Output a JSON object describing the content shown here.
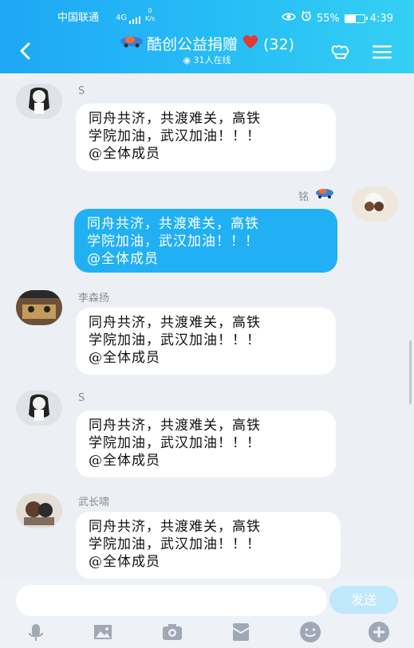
{
  "status": {
    "carrier": "中国联通",
    "signal": "4G",
    "net_speed_top": "0",
    "net_speed_bottom": "K/s",
    "battery": "55%",
    "time": "4:39"
  },
  "header": {
    "title": "酷创公益捐赠",
    "count": "(32)",
    "online": "31人在线"
  },
  "messages": [
    {
      "sender": "S",
      "text": "同舟共济，共渡难关，高铁\n学院加油，武汉加油！！！\n@全体成员"
    },
    {
      "sender": "铭",
      "text": "同舟共济，共渡难关，高铁\n学院加油，武汉加油！！！\n@全体成员"
    },
    {
      "sender": "李森扬",
      "text": "同舟共济，共渡难关，高铁\n学院加油，武汉加油！！！\n@全体成员"
    },
    {
      "sender": "S",
      "text": "同舟共济，共渡难关，高铁\n学院加油，武汉加油！！！\n@全体成员"
    },
    {
      "sender": "武长啸",
      "text": "同舟共济，共渡难关，高铁\n学院加油，武汉加油！！！\n@全体成员"
    }
  ],
  "composer": {
    "placeholder": "",
    "send_label": "发送"
  },
  "icons": {
    "back": "back-icon",
    "group": "group-icon",
    "menu": "menu-icon",
    "voice": "microphone-icon",
    "image": "image-icon",
    "camera": "camera-icon",
    "redpacket": "red-packet-icon",
    "emoji": "emoji-icon",
    "plus": "plus-icon"
  },
  "colors": {
    "header_start": "#1ea7f5",
    "header_end": "#34d0f3",
    "self_bubble": "#21b0f4",
    "send_button": "#bfe8fb",
    "background": "#eceff4"
  }
}
